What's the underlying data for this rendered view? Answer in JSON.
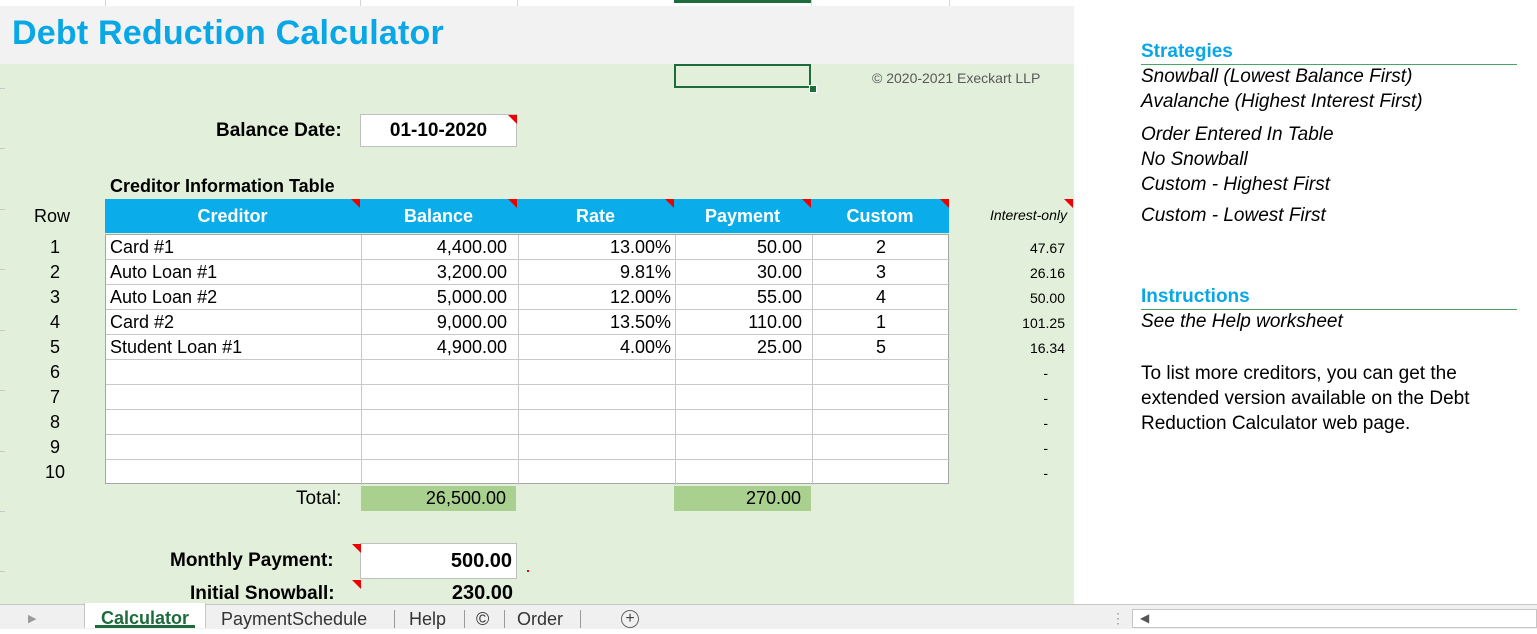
{
  "window": {
    "title": "Debt Reduction Calculator"
  },
  "copyright": "© 2020-2021 Execkart LLP",
  "balance_date": {
    "label": "Balance Date:",
    "value": "01-10-2020"
  },
  "creditor_table": {
    "title": "Creditor Information Table",
    "row_header": "Row",
    "columns": [
      "Creditor",
      "Balance",
      "Rate",
      "Payment",
      "Custom"
    ],
    "interest_only_header": "Interest-only",
    "rows": [
      {
        "row": "1",
        "creditor": "Card #1",
        "balance": "4,400.00",
        "rate": "13.00%",
        "payment": "50.00",
        "custom": "2",
        "interest_only": "47.67"
      },
      {
        "row": "2",
        "creditor": "Auto Loan #1",
        "balance": "3,200.00",
        "rate": "9.81%",
        "payment": "30.00",
        "custom": "3",
        "interest_only": "26.16"
      },
      {
        "row": "3",
        "creditor": "Auto Loan #2",
        "balance": "5,000.00",
        "rate": "12.00%",
        "payment": "55.00",
        "custom": "4",
        "interest_only": "50.00"
      },
      {
        "row": "4",
        "creditor": "Card #2",
        "balance": "9,000.00",
        "rate": "13.50%",
        "payment": "110.00",
        "custom": "1",
        "interest_only": "101.25"
      },
      {
        "row": "5",
        "creditor": "Student Loan #1",
        "balance": "4,900.00",
        "rate": "4.00%",
        "payment": "25.00",
        "custom": "5",
        "interest_only": "16.34"
      },
      {
        "row": "6",
        "creditor": "",
        "balance": "",
        "rate": "",
        "payment": "",
        "custom": "",
        "interest_only": "-"
      },
      {
        "row": "7",
        "creditor": "",
        "balance": "",
        "rate": "",
        "payment": "",
        "custom": "",
        "interest_only": "-"
      },
      {
        "row": "8",
        "creditor": "",
        "balance": "",
        "rate": "",
        "payment": "",
        "custom": "",
        "interest_only": "-"
      },
      {
        "row": "9",
        "creditor": "",
        "balance": "",
        "rate": "",
        "payment": "",
        "custom": "",
        "interest_only": "-"
      },
      {
        "row": "10",
        "creditor": "",
        "balance": "",
        "rate": "",
        "payment": "",
        "custom": "",
        "interest_only": "-"
      }
    ],
    "total_label": "Total:",
    "total_balance": "26,500.00",
    "total_payment": "270.00"
  },
  "monthly_payment": {
    "label": "Monthly Payment:",
    "value": "500.00"
  },
  "initial_snowball": {
    "label": "Initial Snowball:",
    "value": "230.00"
  },
  "strategies": {
    "heading": "Strategies",
    "items": [
      "Snowball (Lowest Balance First)",
      "Avalanche (Highest Interest First)",
      "Order Entered In Table",
      "No Snowball",
      "Custom - Highest First",
      "Custom - Lowest First"
    ]
  },
  "instructions": {
    "heading": "Instructions",
    "text": "See the Help worksheet",
    "note": "To list more creditors, you can get the extended version available on the Debt Reduction Calculator web page."
  },
  "sheet_tabs": [
    "Calculator",
    "PaymentSchedule",
    "Help",
    "©",
    "Order"
  ],
  "active_tab": "Calculator",
  "colors": {
    "accent": "#0aace9",
    "panel": "#e2efda",
    "total_fill": "#a9d08e",
    "excel_green": "#1e6b3c"
  }
}
